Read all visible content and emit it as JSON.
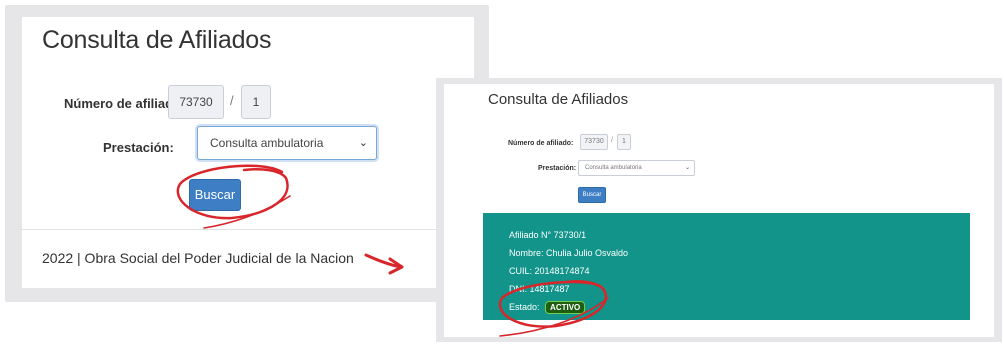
{
  "left_panel": {
    "title": "Consulta de Afiliados",
    "affiliate_label": "Número de afiliado:",
    "affiliate_number": "73730",
    "separator": "/",
    "affiliate_suffix": "1",
    "service_label": "Prestación:",
    "service_value": "Consulta ambulatoria",
    "search_button": "Buscar",
    "footer": "2022 | Obra Social del Poder Judicial de la Nacion"
  },
  "right_panel": {
    "title": "Consulta de Afiliados",
    "affiliate_label": "Número de afiliado:",
    "affiliate_number": "73730",
    "separator": "/",
    "affiliate_suffix": "1",
    "service_label": "Prestación:",
    "service_value": "Consulta ambulatoria",
    "search_button": "Buscar",
    "result": {
      "affiliate": "Afiliado N° 73730/1",
      "name": "Nombre: Chulia Julio Osvaldo",
      "cuil": "CUIL: 20148174874",
      "dni": "DNI: 14817487",
      "status_label": "Estado:",
      "status_value": "ACTIVO"
    }
  },
  "colors": {
    "primary_button": "#3d7ec5",
    "result_background": "#12948a",
    "status_badge": "#1f5e10",
    "annotation": "#d8262b"
  },
  "icons": {
    "select_chevron": "chevron-down-icon",
    "arrow": "arrow-right-icon"
  }
}
